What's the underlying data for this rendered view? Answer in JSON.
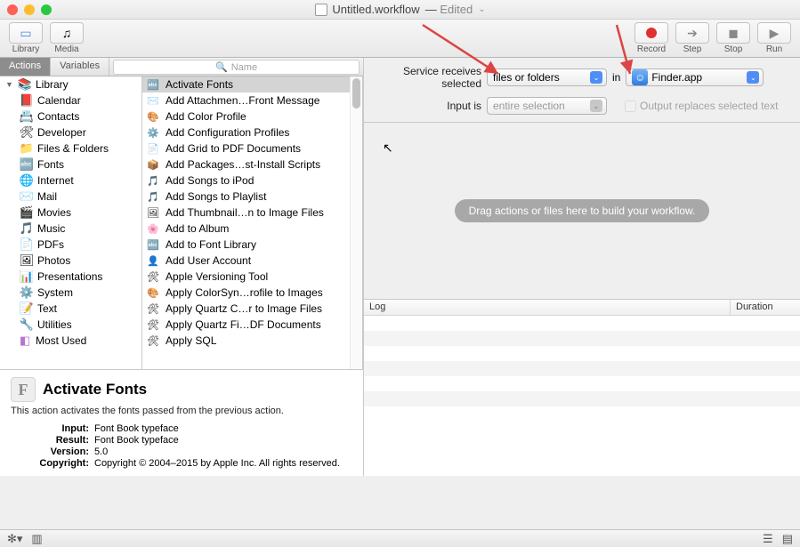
{
  "title": {
    "filename": "Untitled.workflow",
    "edited": "Edited"
  },
  "toolbar": {
    "left": [
      {
        "name": "library",
        "label": "Library"
      },
      {
        "name": "media",
        "label": "Media"
      }
    ],
    "right": [
      {
        "name": "record",
        "label": "Record"
      },
      {
        "name": "step",
        "label": "Step"
      },
      {
        "name": "stop",
        "label": "Stop"
      },
      {
        "name": "run",
        "label": "Run"
      }
    ]
  },
  "tabs": {
    "actions": "Actions",
    "variables": "Variables"
  },
  "search": {
    "placeholder": "Name"
  },
  "library": {
    "header": "Library",
    "items": [
      {
        "label": "Calendar",
        "icon": "📕"
      },
      {
        "label": "Contacts",
        "icon": "📇"
      },
      {
        "label": "Developer",
        "icon": "🛠"
      },
      {
        "label": "Files & Folders",
        "icon": "📁"
      },
      {
        "label": "Fonts",
        "icon": "🔤"
      },
      {
        "label": "Internet",
        "icon": "🌐"
      },
      {
        "label": "Mail",
        "icon": "✉️"
      },
      {
        "label": "Movies",
        "icon": "🎬"
      },
      {
        "label": "Music",
        "icon": "🎵"
      },
      {
        "label": "PDFs",
        "icon": "📄"
      },
      {
        "label": "Photos",
        "icon": "🖼"
      },
      {
        "label": "Presentations",
        "icon": "📊"
      },
      {
        "label": "System",
        "icon": "⚙️"
      },
      {
        "label": "Text",
        "icon": "📝"
      },
      {
        "label": "Utilities",
        "icon": "🔧"
      }
    ],
    "most_used": "Most Used"
  },
  "actions": [
    "Activate Fonts",
    "Add Attachmen…Front Message",
    "Add Color Profile",
    "Add Configuration Profiles",
    "Add Grid to PDF Documents",
    "Add Packages…st-Install Scripts",
    "Add Songs to iPod",
    "Add Songs to Playlist",
    "Add Thumbnail…n to Image Files",
    "Add to Album",
    "Add to Font Library",
    "Add User Account",
    "Apple Versioning Tool",
    "Apply ColorSyn…rofile to Images",
    "Apply Quartz C…r to Image Files",
    "Apply Quartz Fi…DF Documents",
    "Apply SQL"
  ],
  "action_icons": [
    "🔤",
    "✉️",
    "🎨",
    "⚙️",
    "📄",
    "📦",
    "🎵",
    "🎵",
    "🖼",
    "🌸",
    "🔤",
    "👤",
    "🛠",
    "🎨",
    "🛠",
    "🛠",
    "🛠"
  ],
  "config": {
    "receives_label": "Service receives selected",
    "receives_value": "files or folders",
    "in_label": "in",
    "app_value": "Finder.app",
    "input_is_label": "Input is",
    "input_is_value": "entire selection",
    "output_replaces": "Output replaces selected text"
  },
  "canvas_hint": "Drag actions or files here to build your workflow.",
  "info": {
    "title": "Activate Fonts",
    "desc": "This action activates the fonts passed from the previous action.",
    "meta": {
      "Input": "Font Book typeface",
      "Result": "Font Book typeface",
      "Version": "5.0",
      "Copyright": "Copyright © 2004–2015 by Apple Inc. All rights reserved."
    }
  },
  "log": {
    "col1": "Log",
    "col2": "Duration"
  }
}
